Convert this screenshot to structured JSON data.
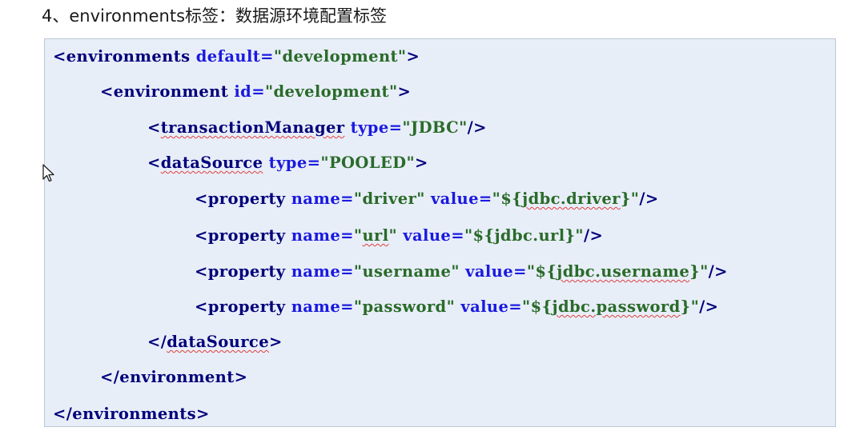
{
  "heading": "4、environments标签：数据源环境配置标签",
  "code": {
    "line1": {
      "open": "<environments",
      "attr": " default=",
      "value": "\"development\"",
      "close": ">"
    },
    "line2": {
      "open": "<environment",
      "attr": " id=",
      "value": "\"development\"",
      "close": ">"
    },
    "line3": {
      "lt": "<",
      "name": "transactionManager",
      "attr": " type=",
      "value": "\"JDBC\"",
      "close": "/>"
    },
    "line4": {
      "lt": "<",
      "name": "dataSource",
      "attr": " type=",
      "value": "\"POOLED\"",
      "close": ">"
    },
    "line5": {
      "open": "<property",
      "attr1": " name=",
      "value1": "\"driver\"",
      "attr2": " value=",
      "v_pre": "\"${",
      "v_sq": "jdbc.driver",
      "v_post": "}\"",
      "close": "/>"
    },
    "line6": {
      "open": "<property",
      "attr1": " name=",
      "v1_pre": "\"",
      "v1_sq": "url",
      "v1_post": "\"",
      "attr2": " value=",
      "value2": "\"${jdbc.url}\"",
      "close": "/>"
    },
    "line7": {
      "open": "<property",
      "attr1": " name=",
      "value1": "\"username\"",
      "attr2": " value=",
      "v_pre": "\"${",
      "v_sq": "jdbc.username",
      "v_post": "}\"",
      "close": "/>"
    },
    "line8": {
      "open": "<property",
      "attr1": " name=",
      "value1": "\"password\"",
      "attr2": " value=",
      "v_pre": "\"${",
      "v_sq": "jdbc.password",
      "v_post": "}\"",
      "close": "/>"
    },
    "line9": {
      "lt": "</",
      "name": "dataSource",
      "close": ">"
    },
    "line10": {
      "text": "</environment>"
    },
    "line11": {
      "text": "</environments>"
    }
  }
}
